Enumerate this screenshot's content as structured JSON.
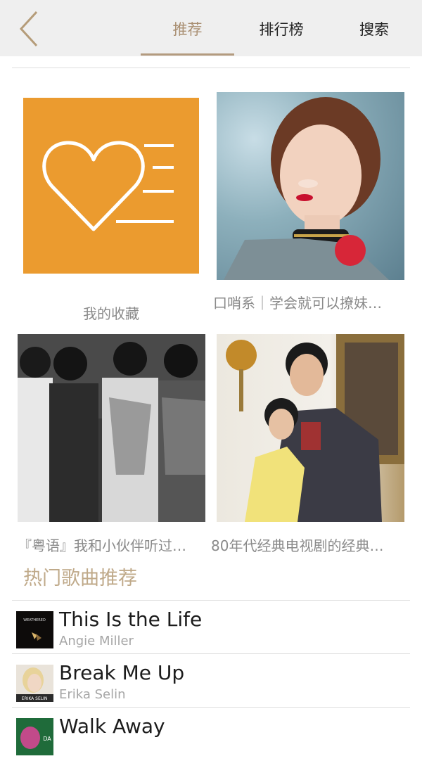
{
  "header": {
    "back_icon": "chevron-left-icon",
    "tabs": [
      {
        "label": "推荐",
        "active": true
      },
      {
        "label": "排行榜",
        "active": false
      },
      {
        "label": "搜索",
        "active": false
      }
    ],
    "accent_color": "#a98f72"
  },
  "playlists": [
    {
      "name": "我的收藏",
      "cover": "favorite-heart-icon"
    },
    {
      "name": "口哨系｜学会就可以撩妹…",
      "cover": "woman-portrait-image"
    },
    {
      "name": "『粤语』我和小伙伴听过…",
      "cover": "band-photo-image"
    },
    {
      "name": "80年代经典电视剧的经典…",
      "cover": "couple-photo-image"
    }
  ],
  "hot_songs": {
    "title": "热门歌曲推荐",
    "items": [
      {
        "title": "This Is the Life",
        "artist": "Angie Miller",
        "cover_text": "WEATHERED"
      },
      {
        "title": "Break Me Up",
        "artist": "Erika Selin",
        "cover_text": "ERIKA SELIN"
      },
      {
        "title": "Walk Away",
        "artist": "",
        "cover_text": "DA"
      }
    ]
  },
  "colors": {
    "topbar": "#efefef",
    "favorite_bg": "#eb9b2f",
    "section_title": "#bfa989"
  }
}
